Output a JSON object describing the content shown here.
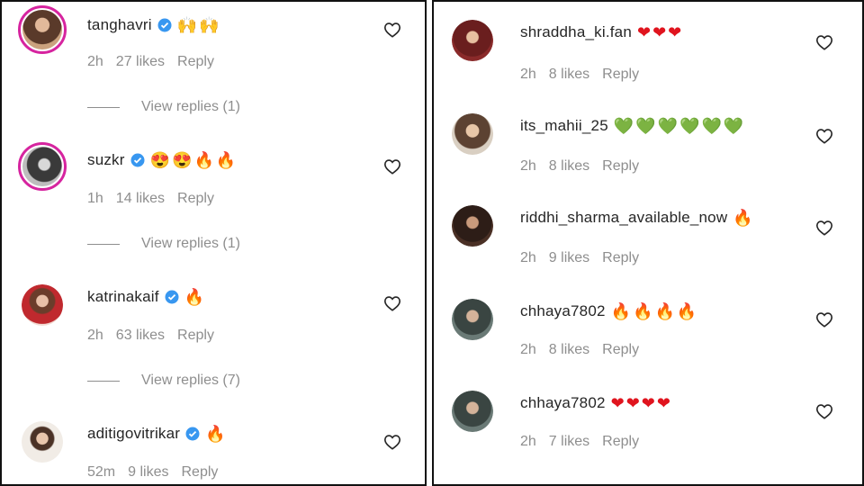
{
  "left_comments": [
    {
      "username": "tanghavri",
      "verified": true,
      "emojis": "🙌🙌",
      "time": "2h",
      "likes": "27 likes",
      "reply": "Reply",
      "view_replies": "View replies (1)"
    },
    {
      "username": "suzkr",
      "verified": true,
      "emojis": "😍😍🔥🔥",
      "time": "1h",
      "likes": "14 likes",
      "reply": "Reply",
      "view_replies": "View replies (1)"
    },
    {
      "username": "katrinakaif",
      "verified": true,
      "emojis": "🔥",
      "time": "2h",
      "likes": "63 likes",
      "reply": "Reply",
      "view_replies": "View replies (7)"
    },
    {
      "username": "aditigovitrikar",
      "verified": true,
      "emojis": "🔥",
      "time": "52m",
      "likes": "9 likes",
      "reply": "Reply"
    }
  ],
  "right_comments": [
    {
      "username": "shraddha_ki.fan",
      "emojis": "❤❤❤",
      "time": "2h",
      "likes": "8 likes",
      "reply": "Reply"
    },
    {
      "username": "its_mahii_25",
      "emojis": "💚💚💚💚💚💚",
      "time": "2h",
      "likes": "8 likes",
      "reply": "Reply"
    },
    {
      "username": "riddhi_sharma_available_now",
      "emojis": "🔥",
      "time": "2h",
      "likes": "9 likes",
      "reply": "Reply"
    },
    {
      "username": "chhaya7802",
      "emojis": "🔥🔥🔥🔥",
      "time": "2h",
      "likes": "8 likes",
      "reply": "Reply"
    },
    {
      "username": "chhaya7802",
      "emojis": "❤❤❤❤",
      "time": "2h",
      "likes": "7 likes",
      "reply": "Reply"
    }
  ],
  "colors": {
    "verified": "#3897f0",
    "meta": "#8e8e8e",
    "story_ring": "#d6249f",
    "red_heart": "#e0141e",
    "green_heart": "#2eb82e"
  },
  "icons": {
    "like": "heart-outline-icon",
    "verified": "verified-badge-icon"
  }
}
